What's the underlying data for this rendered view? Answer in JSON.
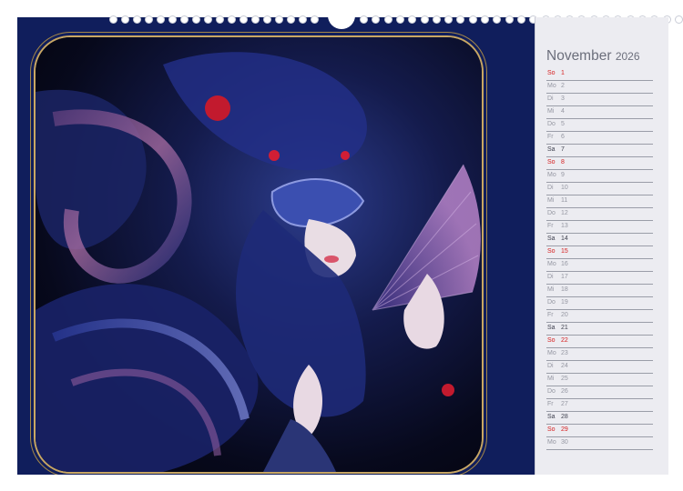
{
  "calendar": {
    "month": "November",
    "year": "2026",
    "days": [
      {
        "wd": "So",
        "d": "1",
        "type": "sun"
      },
      {
        "wd": "Mo",
        "d": "2",
        "type": "week"
      },
      {
        "wd": "Di",
        "d": "3",
        "type": "week"
      },
      {
        "wd": "Mi",
        "d": "4",
        "type": "week"
      },
      {
        "wd": "Do",
        "d": "5",
        "type": "week"
      },
      {
        "wd": "Fr",
        "d": "6",
        "type": "week"
      },
      {
        "wd": "Sa",
        "d": "7",
        "type": "sat"
      },
      {
        "wd": "So",
        "d": "8",
        "type": "sun"
      },
      {
        "wd": "Mo",
        "d": "9",
        "type": "week"
      },
      {
        "wd": "Di",
        "d": "10",
        "type": "week"
      },
      {
        "wd": "Mi",
        "d": "11",
        "type": "week"
      },
      {
        "wd": "Do",
        "d": "12",
        "type": "week"
      },
      {
        "wd": "Fr",
        "d": "13",
        "type": "week"
      },
      {
        "wd": "Sa",
        "d": "14",
        "type": "sat"
      },
      {
        "wd": "So",
        "d": "15",
        "type": "sun"
      },
      {
        "wd": "Mo",
        "d": "16",
        "type": "week"
      },
      {
        "wd": "Di",
        "d": "17",
        "type": "week"
      },
      {
        "wd": "Mi",
        "d": "18",
        "type": "week"
      },
      {
        "wd": "Do",
        "d": "19",
        "type": "week"
      },
      {
        "wd": "Fr",
        "d": "20",
        "type": "week"
      },
      {
        "wd": "Sa",
        "d": "21",
        "type": "sat"
      },
      {
        "wd": "So",
        "d": "22",
        "type": "sun"
      },
      {
        "wd": "Mo",
        "d": "23",
        "type": "week"
      },
      {
        "wd": "Di",
        "d": "24",
        "type": "week"
      },
      {
        "wd": "Mi",
        "d": "25",
        "type": "week"
      },
      {
        "wd": "Do",
        "d": "26",
        "type": "week"
      },
      {
        "wd": "Fr",
        "d": "27",
        "type": "week"
      },
      {
        "wd": "Sa",
        "d": "28",
        "type": "sat"
      },
      {
        "wd": "So",
        "d": "29",
        "type": "sun"
      },
      {
        "wd": "Mo",
        "d": "30",
        "type": "week"
      }
    ]
  },
  "colors": {
    "page_background": "#101e5c",
    "frame_gold": "#c9a763",
    "calendar_panel": "#ececf1",
    "sunday_red": "#d61e1e",
    "saturday_dark": "#404250",
    "weekday_grey": "#9597a2"
  },
  "artwork": {
    "subject": "masked-woman-with-fan"
  }
}
